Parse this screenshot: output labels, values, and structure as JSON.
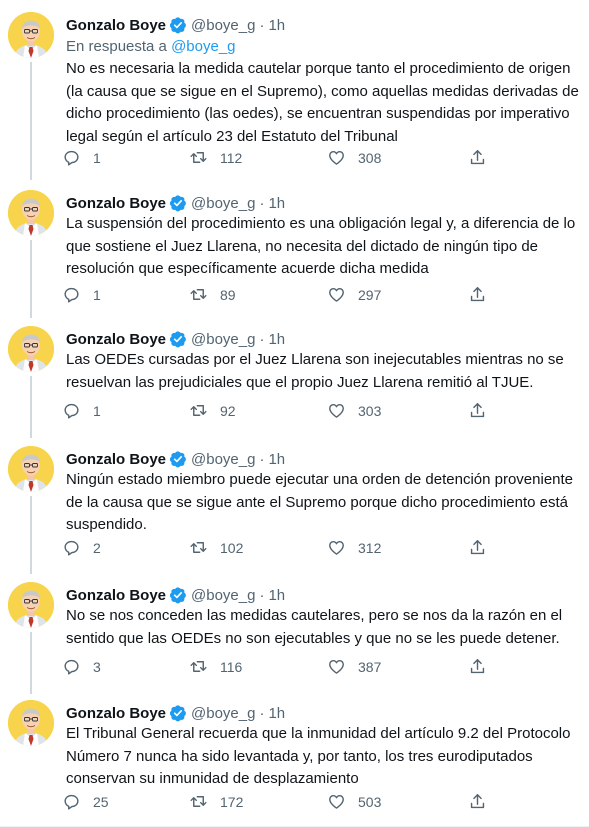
{
  "colors": {
    "text": "#0f1419",
    "secondary": "#536471",
    "link": "#1d9bf0",
    "verified": "#1d9bf0",
    "avatar_bg": "#f7d44c"
  },
  "author": {
    "name": "Gonzalo Boye",
    "handle": "@boye_g",
    "time": "1h",
    "verified_icon": "verified-badge-icon",
    "avatar_icon": "avatar-illustration"
  },
  "reply_to": {
    "prefix": "En respuesta a",
    "handle": "@boye_g"
  },
  "tweets": [
    {
      "text": "No es necesaria la medida cautelar porque tanto el procedimiento de origen (la causa que se sigue en el Supremo), como aquellas medidas derivadas de dicho procedimiento (las oedes), se encuentran suspendidas por imperativo legal según el artículo 23 del Estatuto del Tribunal",
      "replies": "1",
      "retweets": "112",
      "likes": "308"
    },
    {
      "text": "La suspensión del procedimiento es una obligación legal y, a diferencia de lo que sostiene el Juez Llarena, no necesita del dictado de ningún tipo de resolución que específicamente acuerde dicha medida",
      "replies": "1",
      "retweets": "89",
      "likes": "297"
    },
    {
      "text": "Las OEDEs cursadas por el Juez Llarena son inejecutables mientras no se resuelvan las prejudiciales que el propio Juez Llarena remitió al TJUE.",
      "replies": "1",
      "retweets": "92",
      "likes": "303"
    },
    {
      "text": "Ningún estado miembro puede ejecutar una orden de detención proveniente de la causa que se sigue ante el Supremo porque dicho procedimiento está suspendido.",
      "replies": "2",
      "retweets": "102",
      "likes": "312"
    },
    {
      "text": "No se nos conceden las medidas cautelares, pero se nos da la razón en el sentido que las OEDEs no son ejecutables y que no se les puede detener.",
      "replies": "3",
      "retweets": "116",
      "likes": "387"
    },
    {
      "text": "El Tribunal General recuerda que la inmunidad del artículo 9.2 del Protocolo Número 7 nunca ha sido levantada y, por tanto, los tres eurodiputados conservan su inmunidad de desplazamiento",
      "replies": "25",
      "retweets": "172",
      "likes": "503"
    }
  ]
}
